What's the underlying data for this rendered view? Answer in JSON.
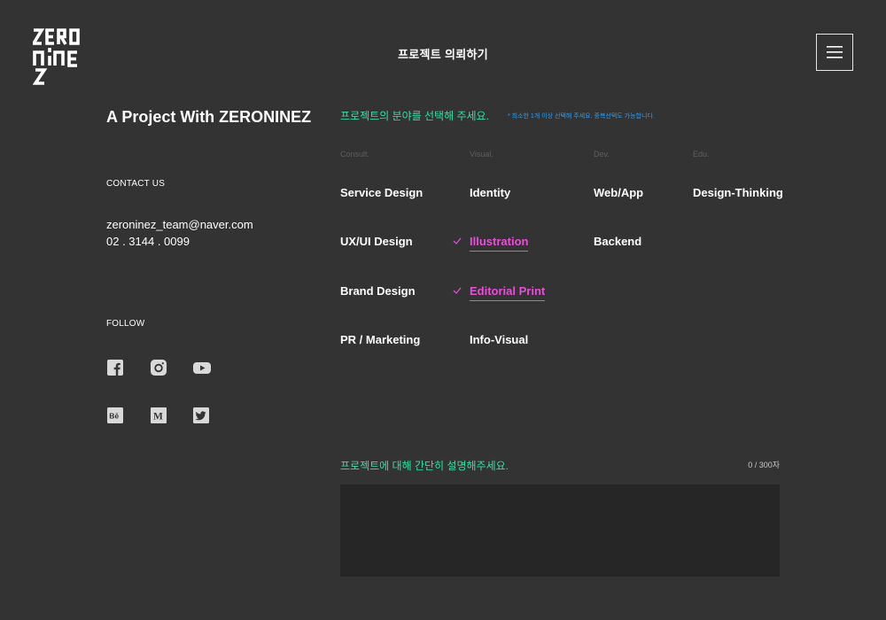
{
  "brand": {
    "logo_text": "ZERONINEZ"
  },
  "header": {
    "title": "프로젝트 의뢰하기",
    "menu_icon": "hamburger-icon"
  },
  "sidebar": {
    "title": "A Project With ZERONINEZ",
    "contact_label": "CONTACT US",
    "email": "zeroninez_team@naver.com",
    "phone": "02 . 3144 . 0099",
    "follow_label": "FOLLOW",
    "social": [
      {
        "name": "facebook",
        "icon": "facebook-icon"
      },
      {
        "name": "instagram",
        "icon": "instagram-icon"
      },
      {
        "name": "youtube",
        "icon": "youtube-icon"
      },
      {
        "name": "behance",
        "icon": "behance-icon"
      },
      {
        "name": "medium",
        "icon": "medium-icon"
      },
      {
        "name": "twitter",
        "icon": "twitter-icon"
      }
    ]
  },
  "fields": {
    "title": "프로젝트의 분야를 선택해 주세요.",
    "note": "* 최소한 1개 이상 선택해 주세요. 중복선택도 가능합니다.",
    "categories": [
      {
        "label": "Consult.",
        "options": [
          {
            "label": "Service Design",
            "selected": false
          },
          {
            "label": "UX/UI Design",
            "selected": false
          },
          {
            "label": "Brand Design",
            "selected": false
          },
          {
            "label": "PR / Marketing",
            "selected": false
          }
        ]
      },
      {
        "label": "Visual.",
        "options": [
          {
            "label": "Identity",
            "selected": false
          },
          {
            "label": "Illustration",
            "selected": true
          },
          {
            "label": "Editorial Print",
            "selected": true
          },
          {
            "label": "Info-Visual",
            "selected": false
          }
        ]
      },
      {
        "label": "Dev.",
        "options": [
          {
            "label": "Web/App",
            "selected": false
          },
          {
            "label": "Backend",
            "selected": false
          }
        ]
      },
      {
        "label": "Edu.",
        "options": [
          {
            "label": "Design-Thinking",
            "selected": false
          }
        ]
      }
    ]
  },
  "description": {
    "title": "프로젝트에 대해 간단히 설명해주세요.",
    "counter": "0 / 300자",
    "value": ""
  },
  "colors": {
    "background": "#333333",
    "accent_green": "#2de0a8",
    "accent_blue": "#2c9cf0",
    "selected_pink": "#e84fd6",
    "textarea_bg": "#262626"
  }
}
